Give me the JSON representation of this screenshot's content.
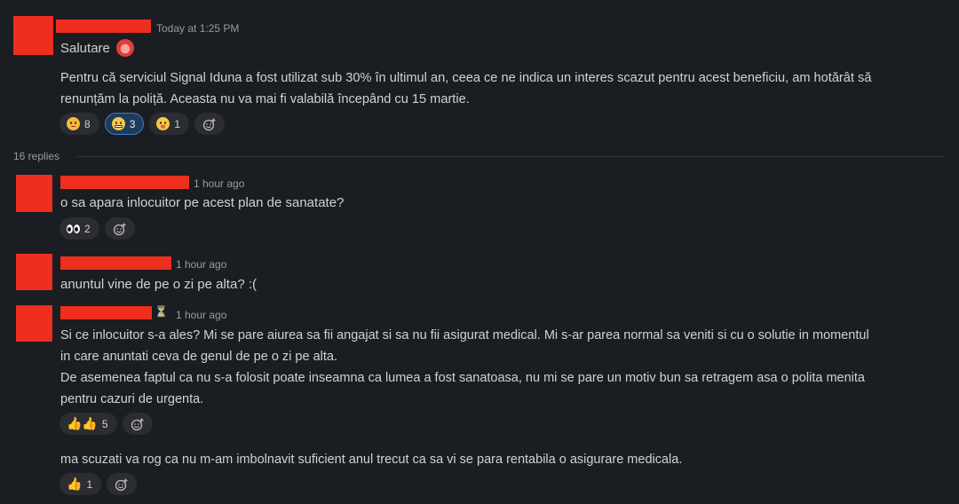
{
  "main_message": {
    "time": "Today at 1:25 PM",
    "greeting": "Salutare",
    "body_line1": "Pentru că serviciul Signal Iduna a fost utilizat sub 30% în ultimul an, ceea ce ne indica un interes scazut pentru acest beneficiu, am hotărât să",
    "body_line2": "renunțăm la poliță. Aceasta nu va mai fi valabilă începând cu 15 martie.",
    "reactions": [
      {
        "icon": "sad-face-icon",
        "count": "8"
      },
      {
        "icon": "grimace-face-icon",
        "count": "3",
        "active": true
      },
      {
        "icon": "tongue-face-icon",
        "count": "1"
      }
    ]
  },
  "thread": {
    "replies_label": "16 replies"
  },
  "reply1": {
    "time": "1 hour ago",
    "text": "o sa apara inlocuitor pe acest plan de sanatate?",
    "reaction": {
      "icon": "eyes-icon",
      "count": "2"
    }
  },
  "reply2": {
    "time": "1 hour ago",
    "text": "anuntul vine de pe o zi pe alta? :("
  },
  "reply3": {
    "time": "1 hour ago",
    "status_icon": "⏳",
    "line1": "Si ce inlocuitor s-a ales? Mi se pare aiurea sa fii angajat si sa nu fii asigurat medical. Mi s-ar parea normal sa veniti si cu o solutie in momentul",
    "line2": "in care anuntati ceva de genul de pe o zi pe alta.",
    "line3": "De asemenea faptul ca nu s-a folosit poate inseamna ca lumea a fost sanatoasa, nu mi se pare un motiv bun sa retragem asa o polita menita",
    "line4": "pentru cazuri de urgenta.",
    "reaction": {
      "icon": "thumbs-up-icon",
      "count": "5"
    },
    "followup": "ma scuzati va rog ca nu m-am imbolnavit suficient anul trecut ca sa vi se para rentabila o asigurare medicala.",
    "followup_reaction": {
      "icon": "thumbs-up-icon",
      "count": "1"
    }
  },
  "colors": {
    "background": "#1a1d21",
    "redaction": "#ee2e1f",
    "active_reaction": "#1f3a5b"
  }
}
